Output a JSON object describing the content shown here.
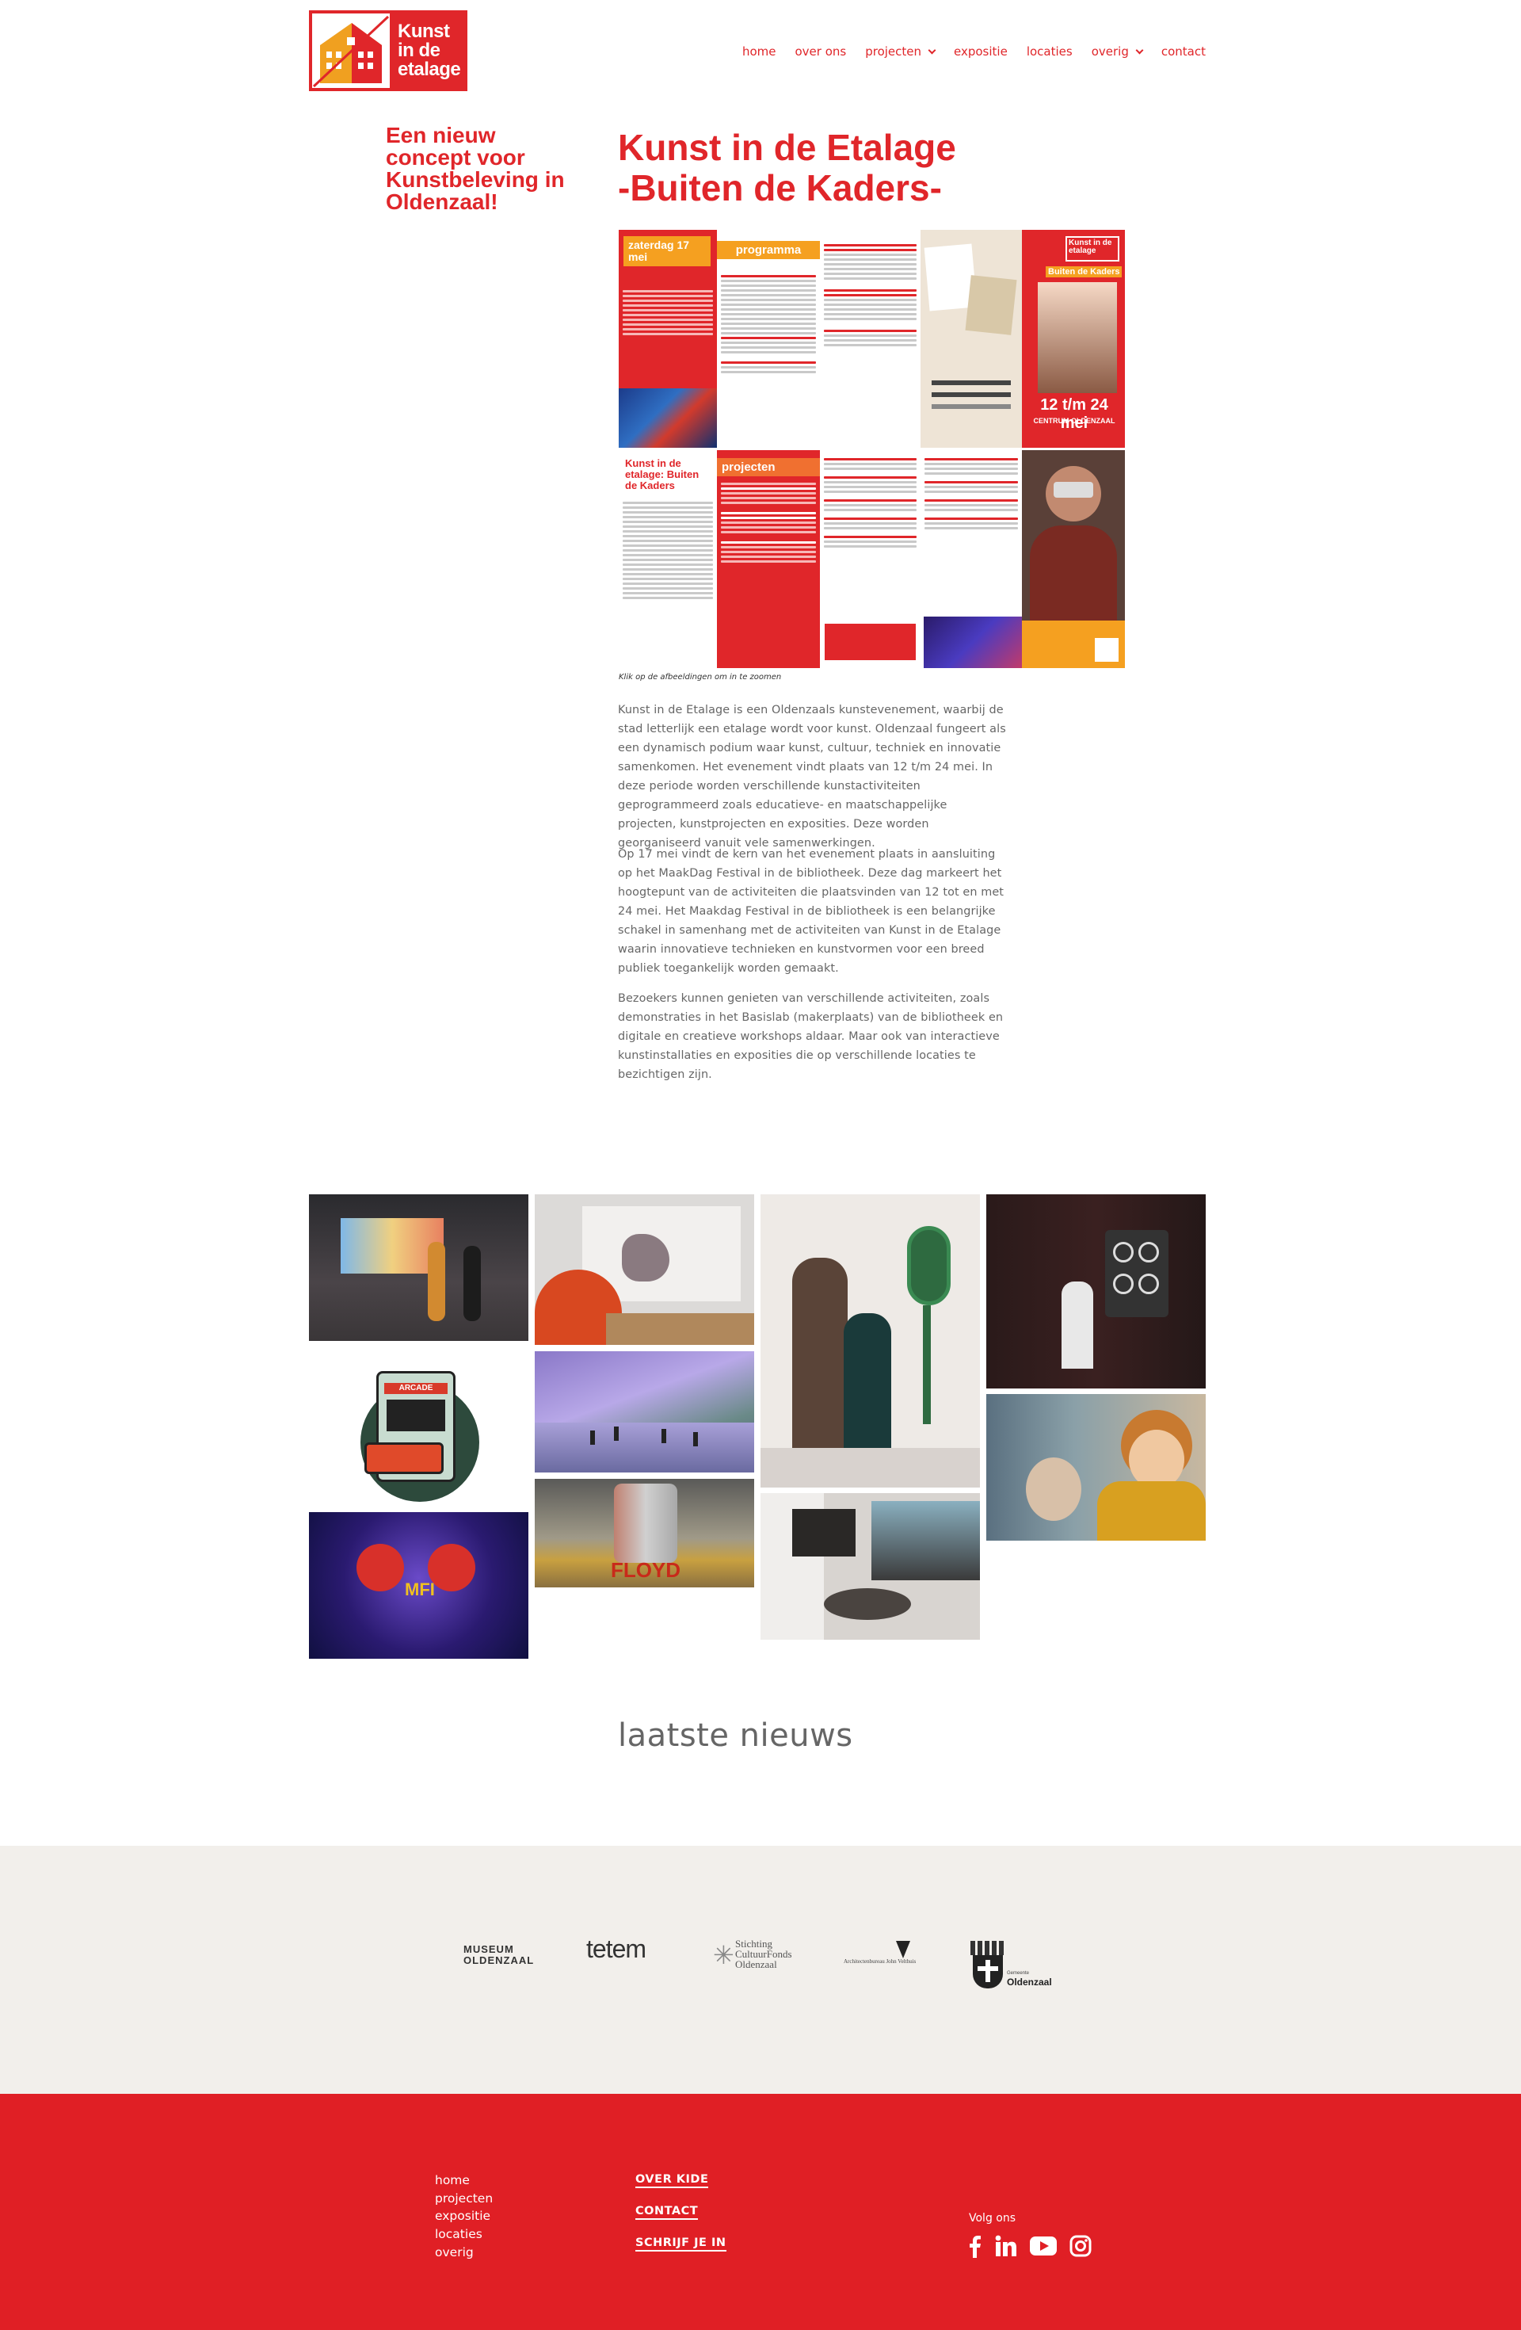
{
  "header": {
    "logo_text": [
      "Kunst",
      "in de",
      "etalage"
    ],
    "nav": [
      {
        "label": "home"
      },
      {
        "label": "over ons"
      },
      {
        "label": "projecten",
        "dropdown": true
      },
      {
        "label": "expositie"
      },
      {
        "label": "locaties"
      },
      {
        "label": "overig",
        "dropdown": true
      },
      {
        "label": "contact"
      }
    ]
  },
  "intro": {
    "tagline": "Een nieuw concept voor Kunstbeleving in Oldenzaal!",
    "heading_line1": "Kunst in de Etalage",
    "heading_line2": "-Buiten de Kaders-",
    "caption": "Klik op de afbeeldingen om in te zoomen"
  },
  "poster": {
    "date": "zaterdag 17 mei",
    "programma": "programma",
    "title": "Kunst in de etalage: Buiten de Kaders",
    "projecten": "projecten",
    "dates": "12 t/m 24 mei",
    "place": "CENTRUM OLDENZAAL",
    "logo_small": "Kunst in de etalage",
    "logo_sub": "Buiten de Kaders"
  },
  "body": {
    "p1": "Kunst in de Etalage is een Oldenzaals kunstevenement, waarbij de stad letterlijk een etalage wordt voor kunst. Oldenzaal fungeert als een dynamisch podium waar kunst, cultuur, techniek en innovatie samenkomen. Het evenement vindt plaats van 12 t/m 24 mei. In deze periode worden verschillende kunstactiviteiten geprogrammeerd zoals educatieve- en maatschappelijke projecten, kunstprojecten en exposities. Deze worden georganiseerd vanuit vele samenwerkingen.",
    "p2": "Op 17 mei vindt de kern van het evenement plaats in aansluiting op het MaakDag Festival in de bibliotheek. Deze dag markeert het hoogtepunt van de activiteiten die plaatsvinden van 12 tot en met 24 mei. Het Maakdag Festival in de bibliotheek is een belangrijke schakel in samenhang met de activiteiten van Kunst in de Etalage waarin innovatieve technieken en kunstvormen voor een breed publiek toegankelijk worden gemaakt.",
    "p3": "Bezoekers kunnen genieten van verschillende activiteiten, zoals demonstraties in het Basislab (makerplaats) van de bibliotheek en digitale en creatieve workshops aldaar. Maar ook van interactieve kunstinstallaties en exposities die op verschillende locaties te bezichtigen zijn."
  },
  "gallery": {
    "arcade_label": "ARCADE",
    "floyd_label": "FLOYD",
    "mfi_label": "MFI"
  },
  "news": {
    "title": "laatste nieuws"
  },
  "sponsors": {
    "museum": [
      "MUSEUM",
      "OLDENZAAL"
    ],
    "tetem": "tetem",
    "stichting": [
      "Stichting",
      "CultuurFonds",
      "Oldenzaal"
    ],
    "architect": "Architectenbureau John Velthuis",
    "gemeente_small": "Gemeente",
    "gemeente": "Oldenzaal"
  },
  "footer": {
    "links": [
      "home",
      "projecten",
      "expositie",
      "locaties",
      "overig"
    ],
    "bold_links": [
      "OVER KIDE",
      "CONTACT",
      "SCHRIJF JE IN"
    ],
    "follow": "Volg ons",
    "social": [
      "facebook-icon",
      "linkedin-icon",
      "youtube-icon",
      "instagram-icon"
    ]
  },
  "colors": {
    "brand": "#e0262a",
    "footer": "#e01f25",
    "sponsor_bg": "#f2efeb"
  }
}
